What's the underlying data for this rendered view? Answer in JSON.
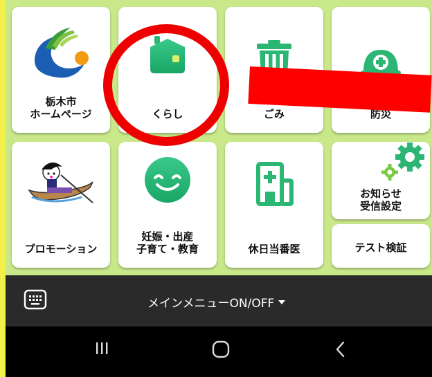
{
  "tiles": {
    "tochigi_home": "栃木市\nホームページ",
    "kurashi": "くらし",
    "gomi": "ごみ",
    "bousai": "防災",
    "promotion": "プロモーション",
    "ninshin": "妊娠・出産\n子育て・教育",
    "kyujitsu": "休日当番医",
    "oshirase": "お知らせ\n受信設定",
    "test": "テスト検証"
  },
  "menu": {
    "toggle_label": "メインメニューON/OFF"
  },
  "colors": {
    "grid_bg": "#c9e88a",
    "icon_green": "#2bb673",
    "annotation_red": "#ee0000"
  },
  "icons": {
    "tochigi_home": "city-emblem-icon",
    "kurashi": "house-icon",
    "gomi": "trash-can-icon",
    "bousai": "helmet-icon",
    "promotion": "boat-mascot-icon",
    "ninshin": "smiley-face-icon",
    "kyujitsu": "hospital-icon",
    "oshirase": "gear-icon",
    "keyboard": "keyboard-icon",
    "dropdown": "caret-down-icon"
  }
}
